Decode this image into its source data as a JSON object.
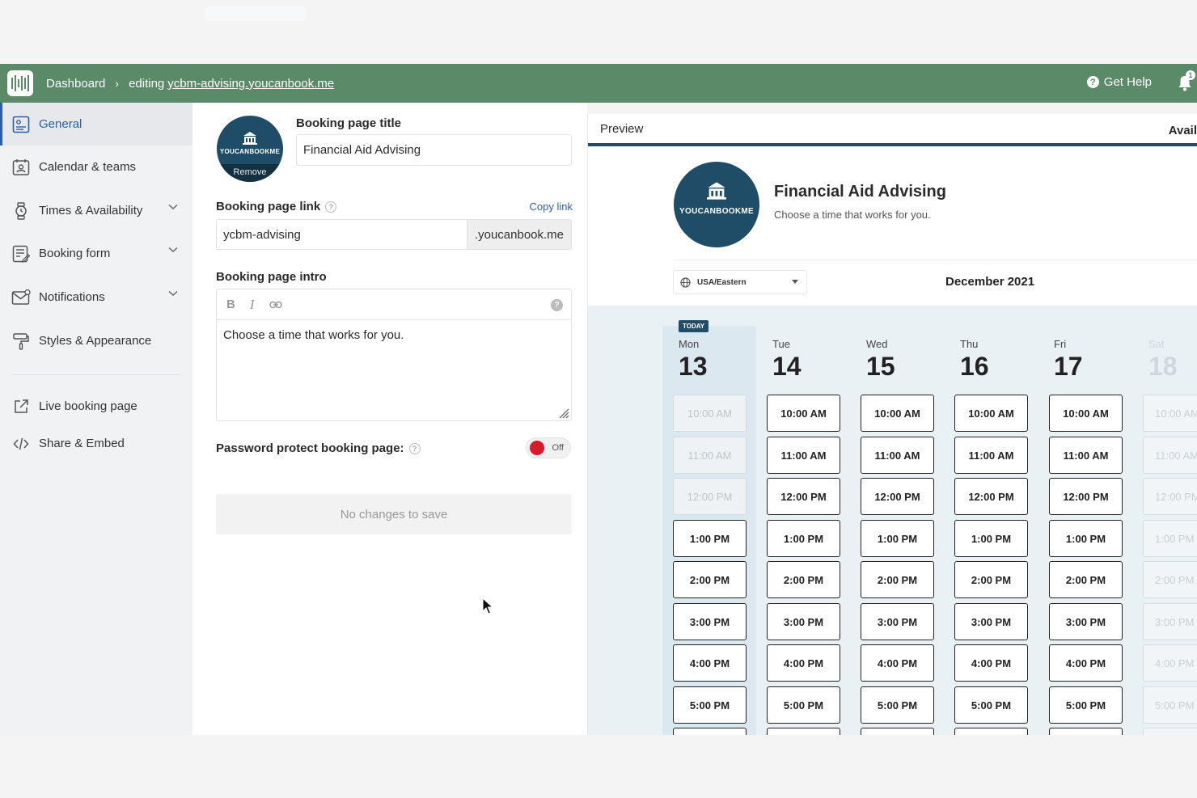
{
  "header": {
    "breadcrumb_root": "Dashboard",
    "breadcrumb_sep": "›",
    "editing_prefix": "editing",
    "editing_link": "ycbm-advising.youcanbook.me",
    "help_label": "Get Help",
    "notification_count": "1"
  },
  "sidebar": {
    "items": [
      {
        "label": "General",
        "icon": "general-icon",
        "active": true
      },
      {
        "label": "Calendar & teams",
        "icon": "calendar-teams-icon"
      },
      {
        "label": "Times & Availability",
        "icon": "watch-icon",
        "expandable": true
      },
      {
        "label": "Booking form",
        "icon": "form-icon",
        "expandable": true
      },
      {
        "label": "Notifications",
        "icon": "envelope-icon",
        "expandable": true
      },
      {
        "label": "Styles & Appearance",
        "icon": "paint-roller-icon"
      },
      {
        "label": "Live booking page",
        "icon": "external-link-icon"
      },
      {
        "label": "Share & Embed",
        "icon": "code-icon"
      }
    ]
  },
  "editor": {
    "logo_text": "YOUCANBOOKME",
    "logo_remove": "Remove",
    "title_label": "Booking page title",
    "title_value": "Financial Aid Advising",
    "link_label": "Booking page link",
    "copy_link": "Copy link",
    "link_value": "ycbm-advising",
    "link_suffix": ".youcanbook.me",
    "intro_label": "Booking page intro",
    "intro_value": "Choose a time that works for you.",
    "toolbar_bold": "B",
    "toolbar_italic": "I",
    "password_label": "Password protect booking page:",
    "password_toggle": "Off",
    "save_label": "No changes to save"
  },
  "preview": {
    "tab_label": "Preview",
    "tab_right": "Avail",
    "logo_text": "YOUCANBOOKME",
    "title": "Financial Aid Advising",
    "subtitle": "Choose a time that works for you.",
    "timezone": "USA/Eastern",
    "month": "December 2021",
    "today_badge": "TODAY",
    "times": [
      "10:00 AM",
      "11:00 AM",
      "12:00 PM",
      "1:00 PM",
      "2:00 PM",
      "3:00 PM",
      "4:00 PM",
      "5:00 PM"
    ],
    "days": [
      {
        "name": "Mon",
        "date": "13",
        "state": "today"
      },
      {
        "name": "Tue",
        "date": "14",
        "state": "normal"
      },
      {
        "name": "Wed",
        "date": "15",
        "state": "normal"
      },
      {
        "name": "Thu",
        "date": "16",
        "state": "normal"
      },
      {
        "name": "Fri",
        "date": "17",
        "state": "normal"
      },
      {
        "name": "Sat",
        "date": "18",
        "state": "faded"
      }
    ],
    "today_past_slots": 3
  },
  "colors": {
    "header": "#5a8a68",
    "accent": "#2c5fa8",
    "brand_navy": "#1f4c66",
    "toggle_off": "#d81b2a"
  }
}
